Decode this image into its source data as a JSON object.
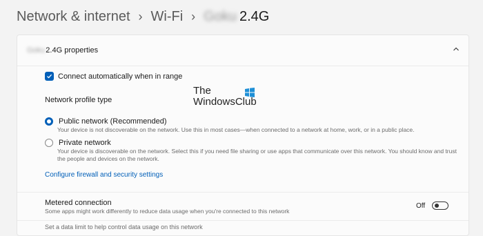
{
  "breadcrumb": {
    "root": "Network & internet",
    "parent": "Wi-Fi",
    "network_blurred": "Goku",
    "network_suffix": "2.4G"
  },
  "properties": {
    "header_blurred": "Goku",
    "header_suffix": "2.4G properties",
    "connect_auto_label": "Connect automatically when in range",
    "connect_auto_checked": true,
    "profile_type_label": "Network profile type",
    "public": {
      "title": "Public network (Recommended)",
      "desc": "Your device is not discoverable on the network. Use this in most cases—when connected to a network at home, work, or in a public place.",
      "selected": true
    },
    "private": {
      "title": "Private network",
      "desc": "Your device is discoverable on the network. Select this if you need file sharing or use apps that communicate over this network. You should know and trust the people and devices on the network.",
      "selected": false
    },
    "firewall_link": "Configure firewall and security settings",
    "metered": {
      "title": "Metered connection",
      "desc": "Some apps might work differently to reduce data usage when you're connected to this network",
      "state": "Off"
    },
    "cutoff_text": "Set a data limit to help control data usage on this network"
  },
  "watermark": {
    "line1": "The",
    "line2": "WindowsClub"
  },
  "colors": {
    "accent": "#005fb8",
    "background": "#f3f3f3",
    "card": "#fbfbfb"
  }
}
